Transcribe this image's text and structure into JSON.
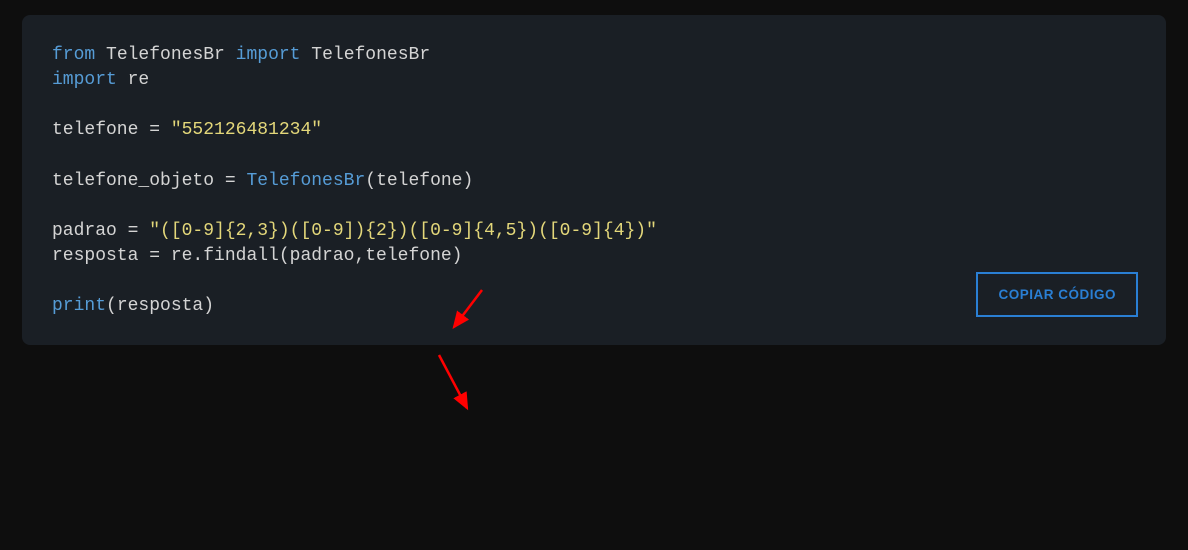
{
  "code": {
    "line1": {
      "kw_from": "from",
      "mod1": "TelefonesBr",
      "kw_import": "import",
      "name1": "TelefonesBr"
    },
    "line2": {
      "kw_import": "import",
      "mod_re": "re"
    },
    "line3_var": "telefone",
    "line3_eq": " = ",
    "line3_str": "\"552126481234\"",
    "line4_var": "telefone_objeto",
    "line4_eq": " = ",
    "line4_call": "TelefonesBr",
    "line4_arg": "(telefone)",
    "line5_var": "padrao",
    "line5_eq": " = ",
    "line5_str": "\"([0-9]{2,3})([0-9]){2})([0-9]{4,5})([0-9]{4})\"",
    "line6_var": "resposta",
    "line6_eq": " = ",
    "line6_call": "re.findall(padrao,telefone)",
    "line7_print": "print",
    "line7_arg": "(resposta)"
  },
  "button": {
    "copy_label": "COPIAR CÓDIGO"
  },
  "annotation": {
    "arrow_color": "#ff0000"
  }
}
